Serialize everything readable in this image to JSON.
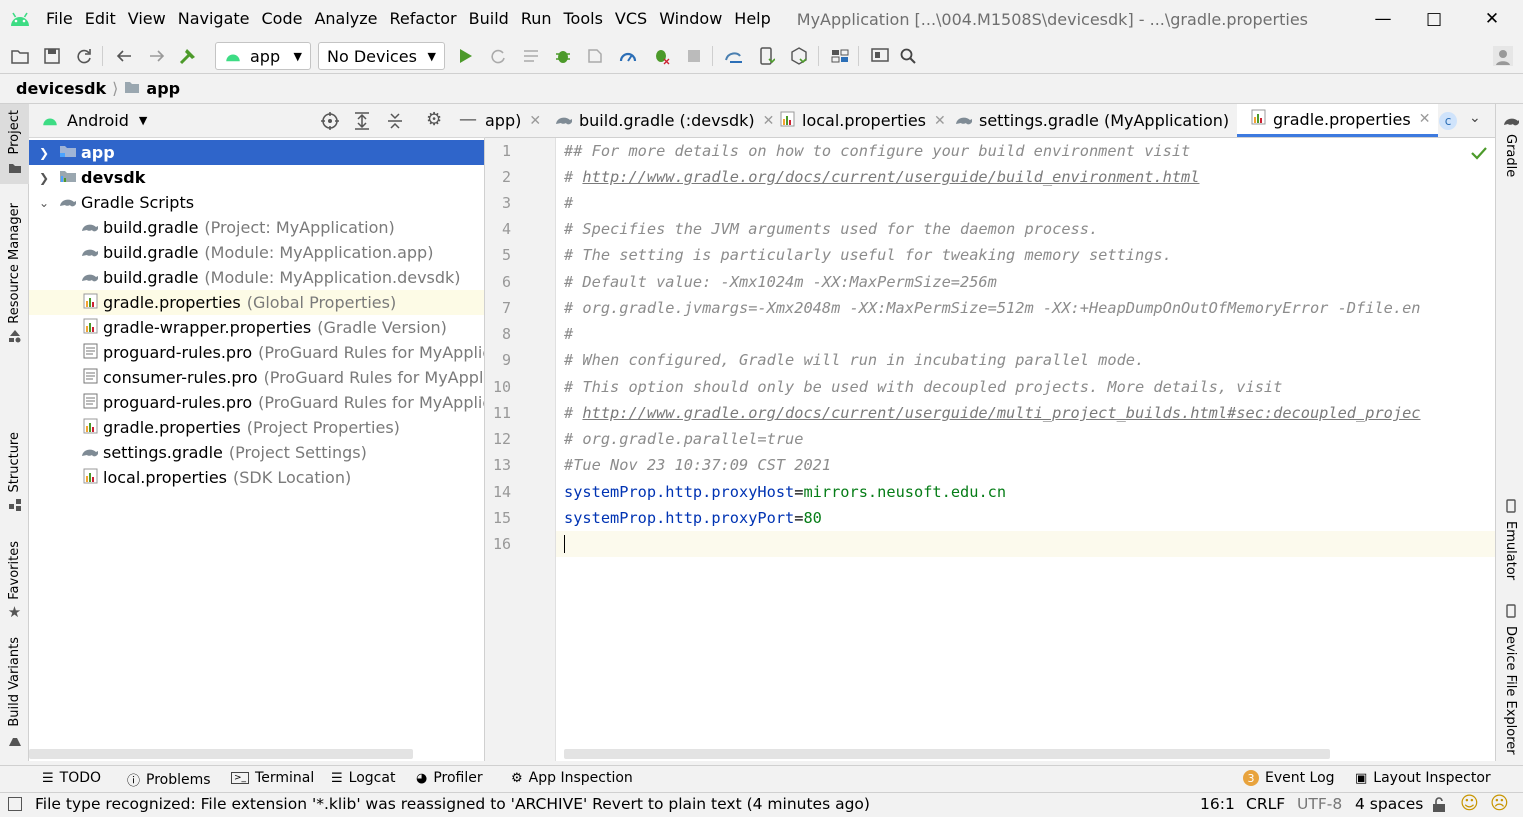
{
  "menu": {
    "items": [
      "File",
      "Edit",
      "View",
      "Navigate",
      "Code",
      "Analyze",
      "Refactor",
      "Build",
      "Run",
      "Tools",
      "VCS",
      "Window",
      "Help"
    ],
    "window_title": "MyApplication [...\\004.M1508S\\devicesdk] - ...\\gradle.properties"
  },
  "toolbar": {
    "run_config": "app",
    "device": "No Devices"
  },
  "breadcrumb": {
    "items": [
      "devicesdk",
      "app"
    ]
  },
  "left_stripe": {
    "project": "Project",
    "resource_manager": "Resource Manager",
    "structure": "Structure",
    "favorites": "Favorites",
    "build_variants": "Build Variants"
  },
  "right_stripe": {
    "gradle": "Gradle",
    "emulator": "Emulator",
    "device_file_explorer": "Device File Explorer"
  },
  "project_panel": {
    "view": "Android",
    "tree": [
      {
        "label": "app",
        "hint": ""
      },
      {
        "label": "devsdk",
        "hint": ""
      },
      {
        "label": "Gradle Scripts",
        "hint": ""
      },
      {
        "label": "build.gradle",
        "hint": "(Project: MyApplication)"
      },
      {
        "label": "build.gradle",
        "hint": "(Module: MyApplication.app)"
      },
      {
        "label": "build.gradle",
        "hint": "(Module: MyApplication.devsdk)"
      },
      {
        "label": "gradle.properties",
        "hint": "(Global Properties)"
      },
      {
        "label": "gradle-wrapper.properties",
        "hint": "(Gradle Version)"
      },
      {
        "label": "proguard-rules.pro",
        "hint": "(ProGuard Rules for MyApplicati"
      },
      {
        "label": "consumer-rules.pro",
        "hint": "(ProGuard Rules for MyApplicati"
      },
      {
        "label": "proguard-rules.pro",
        "hint": "(ProGuard Rules for MyApplicati"
      },
      {
        "label": "gradle.properties",
        "hint": "(Project Properties)"
      },
      {
        "label": "settings.gradle",
        "hint": "(Project Settings)"
      },
      {
        "label": "local.properties",
        "hint": "(SDK Location)"
      }
    ]
  },
  "editor_tabs": [
    "app)",
    "build.gradle (:devsdk)",
    "local.properties",
    "settings.gradle (MyApplication)",
    "gradle.properties"
  ],
  "editor": {
    "line_numbers": [
      "1",
      "2",
      "3",
      "4",
      "5",
      "6",
      "7",
      "8",
      "9",
      "10",
      "11",
      "12",
      "13",
      "14",
      "15",
      "16"
    ],
    "comment_lines": [
      "## For more details on how to configure your build environment visit",
      "# ",
      "#",
      "# Specifies the JVM arguments used for the daemon process.",
      "# The setting is particularly useful for tweaking memory settings.",
      "# Default value: -Xmx1024m -XX:MaxPermSize=256m",
      "# org.gradle.jvmargs=-Xmx2048m -XX:MaxPermSize=512m -XX:+HeapDumpOnOutOfMemoryError -Dfile.en",
      "#",
      "# When configured, Gradle will run in incubating parallel mode.",
      "# This option should only be used with decoupled projects. More details, visit",
      "# ",
      "# org.gradle.parallel=true",
      "#Tue Nov 23 10:37:09 CST 2021"
    ],
    "link1": "http://www.gradle.org/docs/current/userguide/build_environment.html",
    "link2": "http://www.gradle.org/docs/current/userguide/multi_project_builds.html#sec:decoupled_projec",
    "prop1_key": "systemProp.http.proxyHost",
    "prop1_val": "mirrors.neusoft.edu.cn",
    "prop2_key": "systemProp.http.proxyPort",
    "prop2_val": "80",
    "eq": "="
  },
  "bottom_tools": {
    "todo": "TODO",
    "problems": "Problems",
    "terminal": "Terminal",
    "logcat": "Logcat",
    "profiler": "Profiler",
    "app_inspection": "App Inspection",
    "event_log_count": "3",
    "event_log": "Event Log",
    "layout_inspector": "Layout Inspector"
  },
  "status": {
    "message": "File type recognized: File extension '*.klib' was reassigned to 'ARCHIVE' Revert to plain text (4 minutes ago)",
    "position": "16:1",
    "line_sep": "CRLF",
    "encoding": "UTF-8",
    "indent": "4 spaces"
  },
  "colors": {
    "accent": "#2f65ca",
    "android_green": "#3ddc84",
    "comment": "#8c8c8c",
    "prop_key": "#0033b3",
    "prop_value": "#067d17"
  }
}
